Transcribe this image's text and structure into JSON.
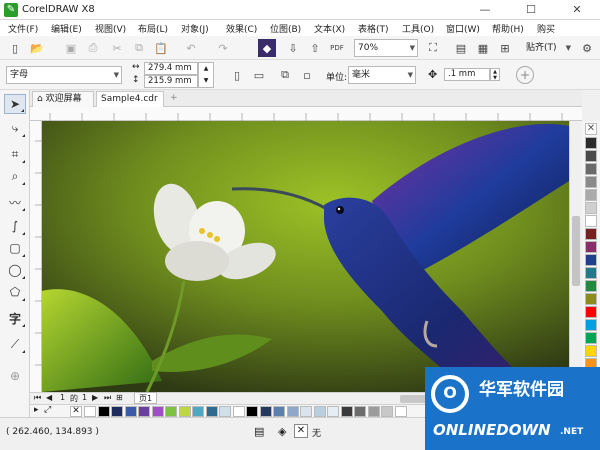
{
  "app": {
    "title": "CorelDRAW X8"
  },
  "menu": [
    "文件(F)",
    "编辑(E)",
    "视图(V)",
    "布局(L)",
    "对象(J)",
    "效果(C)",
    "位图(B)",
    "文本(X)",
    "表格(T)",
    "工具(O)",
    "窗口(W)",
    "帮助(H)",
    "购买"
  ],
  "toolbar": {
    "zoom_value": "70%",
    "snap_label": "贴齐(T)"
  },
  "propbar": {
    "object_type": "字母",
    "width": "279.4 mm",
    "height": "215.9 mm",
    "unit_label": "单位:",
    "unit_value": "毫米",
    "nudge_value": ".1 mm"
  },
  "tabs": [
    {
      "label": "欢迎屏幕"
    },
    {
      "label": "Sample4.cdr"
    }
  ],
  "pages": {
    "current": "1",
    "of": "的",
    "total": "1",
    "page_tab": "页1"
  },
  "status": {
    "coords": "( 262.460, 134.893 )",
    "fill_none": "无"
  },
  "watermark": {
    "line1": "华军软件园",
    "line2": "ONLINEDOWN",
    "suffix": ".NET"
  },
  "colors": {
    "accent": "#2a9d2a",
    "watermark": "#1a73c8"
  },
  "palette_colors": [
    "#2b2b2b",
    "#4a4a4a",
    "#6a6a6a",
    "#8a8a8a",
    "#aaaaaa",
    "#cfcfcf",
    "#ffffff",
    "#7a1f1f",
    "#8b2c6b",
    "#1f3f8b",
    "#1f7a8b",
    "#1f8b3f",
    "#8b8b1f",
    "#ff0000",
    "#00a0e0",
    "#00a651",
    "#ffd400",
    "#f7941d",
    "#ec008c"
  ],
  "doc_colors": [
    "#ffffff",
    "#000000",
    "#1d2b5f",
    "#3c5aa8",
    "#6a3fa0",
    "#a04ec3",
    "#7dc242",
    "#c0d83f",
    "#4fa7c4",
    "#2f6a8f",
    "#cfe0ea",
    "#ffffff",
    "#000000",
    "#23395d",
    "#5b7fb0",
    "#8fa7c8",
    "#d9e4ef",
    "#b8cfe0",
    "#e6eef5",
    "#3a3a3a",
    "#6c6c6c",
    "#9c9c9c",
    "#c8c8c8",
    "#ffffff"
  ]
}
